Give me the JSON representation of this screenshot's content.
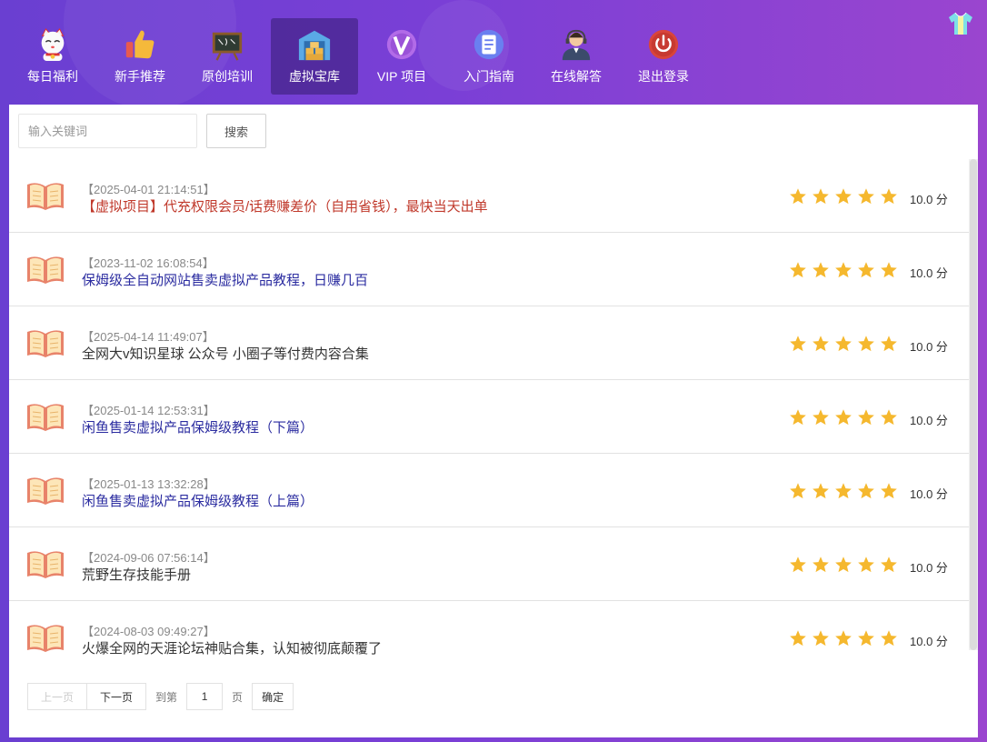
{
  "nav": {
    "items": [
      {
        "label": "每日福利",
        "icon": "lucky-cat-icon"
      },
      {
        "label": "新手推荐",
        "icon": "thumbs-up-icon"
      },
      {
        "label": "原创培训",
        "icon": "blackboard-icon"
      },
      {
        "label": "虚拟宝库",
        "icon": "warehouse-icon",
        "active": true
      },
      {
        "label": "VIP 项目",
        "icon": "vip-icon"
      },
      {
        "label": "入门指南",
        "icon": "document-icon"
      },
      {
        "label": "在线解答",
        "icon": "support-agent-icon"
      },
      {
        "label": "退出登录",
        "icon": "power-icon"
      }
    ]
  },
  "header": {
    "theme_icon": "shirt-icon"
  },
  "search": {
    "placeholder": "输入关键词",
    "value": "",
    "button_label": "搜索"
  },
  "list": {
    "items": [
      {
        "date": "【2025-04-01 21:14:51】",
        "title": "【虚拟项目】代充权限会员/话费赚差价（自用省钱），最快当天出单",
        "title_color": "#c0392b",
        "stars": 5,
        "score": "10.0 分"
      },
      {
        "date": "【2023-11-02 16:08:54】",
        "title": "保姆级全自动网站售卖虚拟产品教程，日赚几百",
        "title_color": "#2b2ca0",
        "stars": 5,
        "score": "10.0 分"
      },
      {
        "date": "【2025-04-14 11:49:07】",
        "title": "全网大v知识星球 公众号 小圈子等付费内容合集",
        "title_color": "#333333",
        "stars": 5,
        "score": "10.0 分"
      },
      {
        "date": "【2025-01-14 12:53:31】",
        "title": "闲鱼售卖虚拟产品保姆级教程（下篇）",
        "title_color": "#2b2ca0",
        "stars": 5,
        "score": "10.0 分"
      },
      {
        "date": "【2025-01-13 13:32:28】",
        "title": "闲鱼售卖虚拟产品保姆级教程（上篇）",
        "title_color": "#2b2ca0",
        "stars": 5,
        "score": "10.0 分"
      },
      {
        "date": "【2024-09-06 07:56:14】",
        "title": "荒野生存技能手册",
        "title_color": "#333333",
        "stars": 5,
        "score": "10.0 分"
      },
      {
        "date": "【2024-08-03 09:49:27】",
        "title": "火爆全网的天涯论坛神贴合集，认知被彻底颠覆了",
        "title_color": "#333333",
        "stars": 5,
        "score": "10.0 分"
      }
    ]
  },
  "pagination": {
    "prev_label": "上一页",
    "next_label": "下一页",
    "goto_label": "到第",
    "page_value": "1",
    "page_unit": "页",
    "confirm_label": "确定"
  },
  "colors": {
    "accent": "#7a3fd6",
    "star": "#f5b82e",
    "book": "#e8836a"
  }
}
